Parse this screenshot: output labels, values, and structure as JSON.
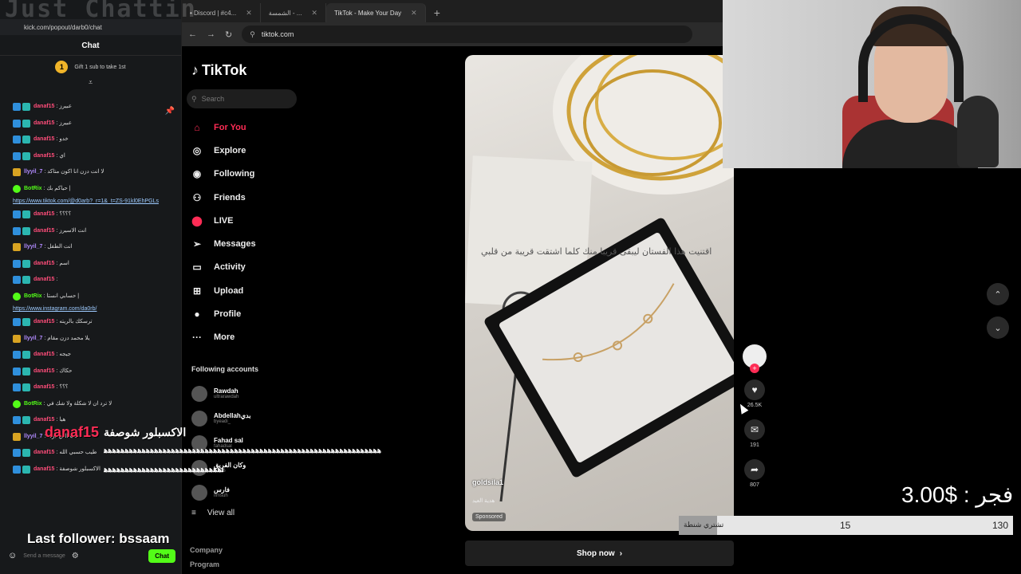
{
  "browser": {
    "tabs": [
      {
        "label": "• Discord | #c4..."
      },
      {
        "label": "الشمسة - ..."
      },
      {
        "label": "TikTok - Make Your Day"
      }
    ],
    "url": "tiktok.com"
  },
  "chat": {
    "url": "kick.com/popout/darb0/chat",
    "title": "Chat",
    "gift_count": "1",
    "gift_text": "Gift 1 sub to take 1st",
    "messages": [
      {
        "user": "danaf15",
        "text": ": عبيرز",
        "badge": "blue",
        "color": "#ff4d7a"
      },
      {
        "user": "danaf15",
        "text": ": عبيرز",
        "badge": "blue",
        "color": "#ff4d7a"
      },
      {
        "user": "danaf15",
        "text": ": خدو",
        "badge": "blue",
        "color": "#ff4d7a"
      },
      {
        "user": "danaf15",
        "text": ": اي",
        "badge": "blue",
        "color": "#ff4d7a"
      },
      {
        "user": "llyyil_7",
        "text": ": لا انت دزن انا اكون متاكد",
        "badge": "gold",
        "color": "#b28bff"
      },
      {
        "user": "BotRix",
        "text": ": حياكم بك |",
        "badge": "green",
        "color": "#53fc18"
      }
    ],
    "link1": "https://www.tiktok.com/@d0arb?_r=1&_t=ZS-91kl0EhPGLs",
    "messages2": [
      {
        "user": "danaf15",
        "text": ": ؟؟؟؟",
        "badge": "blue",
        "color": "#ff4d7a"
      },
      {
        "user": "danaf15",
        "text": ": انت الاسيرز",
        "badge": "blue",
        "color": "#ff4d7a"
      },
      {
        "user": "llyyil_7",
        "text": ": انت الطفل",
        "badge": "gold",
        "color": "#b28bff"
      },
      {
        "user": "danaf15",
        "text": ": اسم",
        "badge": "blue",
        "color": "#ff4d7a"
      },
      {
        "user": "danaf15",
        "text": ":",
        "badge": "blue",
        "color": "#ff4d7a"
      },
      {
        "user": "BotRix",
        "text": ": حسابي انستا |",
        "badge": "green",
        "color": "#53fc18"
      }
    ],
    "link2": "https://www.instagram.com/da0rb/",
    "messages3": [
      {
        "user": "danaf15",
        "text": ": ترسكك بالريته",
        "badge": "blue",
        "color": "#ff4d7a"
      },
      {
        "user": "llyyil_7",
        "text": ": يلا محمد دزن مقام",
        "badge": "gold",
        "color": "#b28bff"
      },
      {
        "user": "danaf15",
        "text": ": جيجه",
        "badge": "blue",
        "color": "#ff4d7a"
      },
      {
        "user": "danaf15",
        "text": ": حكاك",
        "badge": "blue",
        "color": "#ff4d7a"
      },
      {
        "user": "danaf15",
        "text": ": ؟؟؟",
        "badge": "blue",
        "color": "#ff4d7a"
      },
      {
        "user": "BotRix",
        "text": ": لا ترد ان لا شكلة ولا شك في",
        "badge": "green",
        "color": "#53fc18"
      },
      {
        "user": "danaf15",
        "text": ": هيا",
        "badge": "blue",
        "color": "#ff4d7a"
      },
      {
        "user": "llyyil_7",
        "text": ": انت اللي دزته",
        "badge": "gold",
        "color": "#b28bff"
      },
      {
        "user": "danaf15",
        "text": ": طيب حسبي الله",
        "badge": "blue",
        "color": "#ff4d7a"
      },
      {
        "user": "danaf15",
        "text": ": الاكسبلور شوصفة",
        "badge": "blue",
        "color": "#ff4d7a"
      }
    ],
    "spam_line": "ﻫﻫﻫﻫﻫﻫﻫﻫﻫﻫﻫﻫﻫﻫﻫﻫﻫﻫﻫﻫﻫﻫﻫﻫﻫﻫﻫﻫﻫﻫﻫﻫﻫﻫﻫﻫﻫﻫﻫﻫﻫﻫﻫﻫﻫﻫﻫﻫﻫﻫﻫﻫﻫﻫﻫﻫﻫﻫﻫﻫﻫﻫﻫﻫﻫﻫ",
    "input_placeholder": "Send a message",
    "send_label": "Chat"
  },
  "tiktok": {
    "logo": "TikTok",
    "search_placeholder": "Search",
    "nav": [
      {
        "label": "For You",
        "icon": "home-icon",
        "glyph": "⌂"
      },
      {
        "label": "Explore",
        "icon": "compass-icon",
        "glyph": "◎"
      },
      {
        "label": "Following",
        "icon": "following-icon",
        "glyph": "◉"
      },
      {
        "label": "Friends",
        "icon": "friends-icon",
        "glyph": "⚇"
      },
      {
        "label": "LIVE",
        "icon": "live-icon",
        "glyph": "⬤"
      },
      {
        "label": "Messages",
        "icon": "messages-icon",
        "glyph": "➢"
      },
      {
        "label": "Activity",
        "icon": "activity-icon",
        "glyph": "▭"
      },
      {
        "label": "Upload",
        "icon": "upload-icon",
        "glyph": "⊞"
      },
      {
        "label": "Profile",
        "icon": "profile-icon",
        "glyph": "●"
      },
      {
        "label": "More",
        "icon": "more-icon",
        "glyph": "···"
      }
    ],
    "following_header": "Following accounts",
    "accounts": [
      {
        "name": "Rawdah",
        "handle": "ultrarawdah"
      },
      {
        "name": "Abdellahبدي",
        "handle": "byeadi_"
      },
      {
        "name": "Fahad sal",
        "handle": "fahadsal"
      },
      {
        "name": "وكان الفريق",
        "handle": "x.516"
      },
      {
        "name": "فارس",
        "handle": "ifmsuh"
      }
    ],
    "view_all": "View all",
    "footer": [
      "Company",
      "Program"
    ],
    "video": {
      "author": "goldsila1",
      "description": "هدية العيد",
      "sponsored": "Sponsored",
      "card_text": "اقتنيت هذا الفستان ليبقى قريبا منك كلما اشتقت قريبة من قلبي"
    },
    "shop_now": "Shop now",
    "actions": {
      "likes": "26.5K",
      "comments": "191",
      "shares": "807"
    }
  },
  "overlay": {
    "watermark": "Just Chattin",
    "alert_user": "danaf15",
    "alert_text": "الاكسبلور شوصفة",
    "last_follower": "Last follower: bssaam",
    "price": "3.00$ : فجر",
    "goal_label": "تشتري شنطة",
    "goal_current": "15",
    "goal_max": "130",
    "goal_fraction": 0.115
  }
}
